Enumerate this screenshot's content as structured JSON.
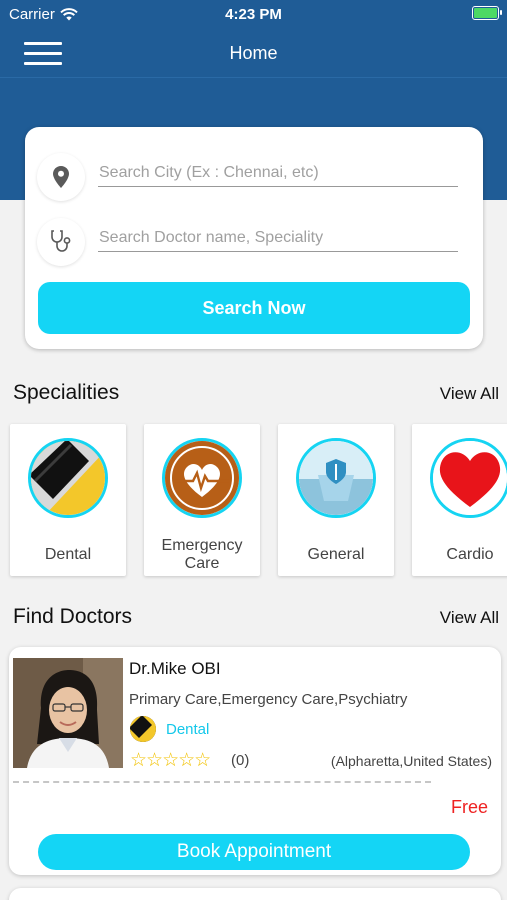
{
  "status_bar": {
    "carrier": "Carrier",
    "time": "4:23 PM"
  },
  "nav": {
    "title": "Home"
  },
  "search": {
    "city_placeholder": "Search City (Ex : Chennai, etc)",
    "doctor_placeholder": "Search Doctor name, Speciality",
    "button_label": "Search Now"
  },
  "specialities": {
    "title": "Specialities",
    "view_all": "View All",
    "items": [
      {
        "label": "Dental"
      },
      {
        "label": "Emergency Care"
      },
      {
        "label": "General"
      },
      {
        "label": "Cardio"
      }
    ]
  },
  "find_doctors": {
    "title": "Find Doctors",
    "view_all": "View All",
    "doctors": [
      {
        "name": "Dr.Mike OBI",
        "specialities": "Primary Care,Emergency Care,Psychiatry",
        "department": "Dental",
        "stars": "☆☆☆☆☆",
        "rating_count": "(0)",
        "location": "(Alpharetta,United States)",
        "fee": "Free",
        "book_label": "Book Appointment"
      }
    ]
  },
  "colors": {
    "header": "#1f5c96",
    "accent": "#14d5f5",
    "fee": "#e22222",
    "star": "#f2c200"
  }
}
